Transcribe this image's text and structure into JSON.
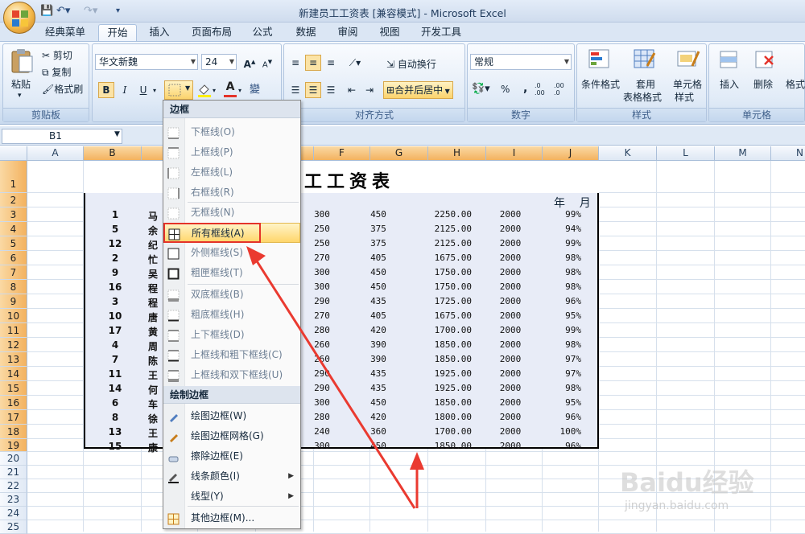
{
  "window": {
    "title": "新建员工工资表  [兼容模式] - Microsoft Excel"
  },
  "tabs": [
    "经典菜单",
    "开始",
    "插入",
    "页面布局",
    "公式",
    "数据",
    "审阅",
    "视图",
    "开发工具"
  ],
  "active_tab": "开始",
  "ribbon": {
    "clipboard": {
      "paste": "粘贴",
      "cut": "剪切",
      "copy": "复制",
      "format_painter": "格式刷",
      "label": "剪贴板"
    },
    "font": {
      "name": "华文新魏",
      "size": "24",
      "bold": "B",
      "italic": "I",
      "underline": "U",
      "grow": "A",
      "shrink": "A"
    },
    "alignment": {
      "wrap": "自动换行",
      "merge": "合并后居中",
      "label": "对齐方式"
    },
    "number": {
      "format": "常规",
      "percent": "%",
      "comma": ",",
      "inc": ".0 .00",
      "dec": ".00 .0",
      "label": "数字"
    },
    "styles": {
      "conditional": "条件格式",
      "table": "套用",
      "table2": "表格格式",
      "cell": "单元格",
      "cell2": "样式",
      "label": "样式"
    },
    "cells": {
      "insert": "插入",
      "delete": "删除",
      "format": "格式",
      "label": "单元格"
    }
  },
  "namebox": "B1",
  "columns": [
    "A",
    "B",
    "C",
    "D",
    "E",
    "F",
    "G",
    "H",
    "I",
    "J",
    "K",
    "L",
    "M",
    "N"
  ],
  "rows": [
    "1",
    "2",
    "3",
    "4",
    "5",
    "6",
    "7",
    "8",
    "9",
    "10",
    "11",
    "12",
    "13",
    "14",
    "15",
    "16",
    "17",
    "18",
    "19",
    "20",
    "21",
    "22",
    "23",
    "24",
    "25"
  ],
  "sheet": {
    "title": "工工资表",
    "year_month": "年    月",
    "data": [
      {
        "id": "1",
        "name": "马",
        "f": "300",
        "g": "450",
        "h": "2250.00",
        "i": "2000",
        "j": "99%"
      },
      {
        "id": "5",
        "name": "余",
        "f": "250",
        "g": "375",
        "h": "2125.00",
        "i": "2000",
        "j": "94%"
      },
      {
        "id": "12",
        "name": "纪",
        "f": "250",
        "g": "375",
        "h": "2125.00",
        "i": "2000",
        "j": "99%"
      },
      {
        "id": "2",
        "name": "忙",
        "f": "270",
        "g": "405",
        "h": "1675.00",
        "i": "2000",
        "j": "98%"
      },
      {
        "id": "9",
        "name": "吴",
        "f": "300",
        "g": "450",
        "h": "1750.00",
        "i": "2000",
        "j": "98%"
      },
      {
        "id": "16",
        "name": "程",
        "f": "300",
        "g": "450",
        "h": "1750.00",
        "i": "2000",
        "j": "98%"
      },
      {
        "id": "3",
        "name": "程",
        "f": "290",
        "g": "435",
        "h": "1725.00",
        "i": "2000",
        "j": "96%"
      },
      {
        "id": "10",
        "name": "唐",
        "f": "270",
        "g": "405",
        "h": "1675.00",
        "i": "2000",
        "j": "95%"
      },
      {
        "id": "17",
        "name": "黄",
        "f": "280",
        "g": "420",
        "h": "1700.00",
        "i": "2000",
        "j": "99%"
      },
      {
        "id": "4",
        "name": "周",
        "f": "260",
        "g": "390",
        "h": "1850.00",
        "i": "2000",
        "j": "98%"
      },
      {
        "id": "7",
        "name": "陈",
        "f": "260",
        "g": "390",
        "h": "1850.00",
        "i": "2000",
        "j": "97%"
      },
      {
        "id": "11",
        "name": "王",
        "f": "290",
        "g": "435",
        "h": "1925.00",
        "i": "2000",
        "j": "97%"
      },
      {
        "id": "14",
        "name": "何",
        "f": "290",
        "g": "435",
        "h": "1925.00",
        "i": "2000",
        "j": "98%"
      },
      {
        "id": "6",
        "name": "车",
        "f": "300",
        "g": "450",
        "h": "1850.00",
        "i": "2000",
        "j": "95%"
      },
      {
        "id": "8",
        "name": "徐",
        "f": "280",
        "g": "420",
        "h": "1800.00",
        "i": "2000",
        "j": "96%"
      },
      {
        "id": "13",
        "name": "王",
        "f": "240",
        "g": "360",
        "h": "1700.00",
        "i": "2000",
        "j": "100%"
      },
      {
        "id": "15",
        "name": "康",
        "f": "300",
        "g": "450",
        "h": "1850.00",
        "i": "2000",
        "j": "96%"
      }
    ]
  },
  "border_menu": {
    "header1": "边框",
    "items1": [
      "下框线(O)",
      "上框线(P)",
      "左框线(L)",
      "右框线(R)",
      "无框线(N)",
      "所有框线(A)",
      "外侧框线(S)",
      "粗匣框线(T)",
      "双底框线(B)",
      "粗底框线(H)",
      "上下框线(D)",
      "上框线和粗下框线(C)",
      "上框线和双下框线(U)"
    ],
    "header2": "绘制边框",
    "items2": [
      "绘图边框(W)",
      "绘图边框网格(G)",
      "擦除边框(E)",
      "线条颜色(I)",
      "线型(Y)",
      "其他边框(M)..."
    ],
    "highlighted": "所有框线(A)"
  },
  "watermark": {
    "brand": "Baidu经验",
    "url": "jingyan.baidu.com"
  },
  "colors": {
    "accent": "#f3b25f",
    "highlight_box": "#e4332a",
    "table_fill": "#e8ecf7"
  }
}
